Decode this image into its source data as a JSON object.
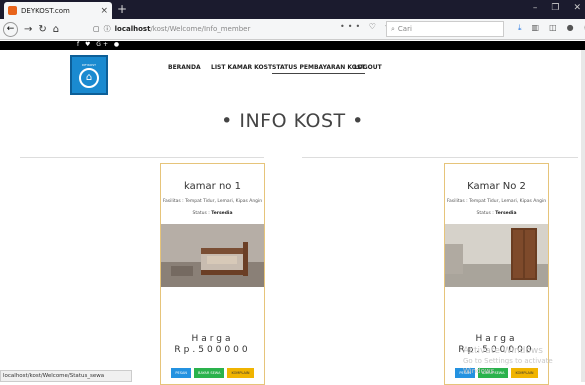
{
  "browser": {
    "tab_title": "DEYKOST.com",
    "tab_close": "×",
    "new_tab": "+",
    "url_host": "localhost",
    "url_path": "/kost/Welcome/Info_member",
    "search_placeholder": "Cari"
  },
  "site": {
    "social": "f ♥ G+ ●",
    "logo_text": "DEYKOST",
    "menu": [
      "BERANDA",
      "LIST KAMAR KOST",
      "STATUS PEMBAYARAN KOST",
      "LOGOUT"
    ],
    "heading": "• INFO KOST •"
  },
  "rooms": [
    {
      "name": "kamar no 1",
      "facilities": "Fasilitas : Tempat Tidur, Lemari, Kipas Angin",
      "status_label": "Status :",
      "status_value": "Tersedia",
      "price_label": "Harga",
      "price_value": "Rp.500000",
      "buttons": [
        "PESAN",
        "BAYAR SEWA",
        "KOMPLAIN"
      ]
    },
    {
      "name": "Kamar No 2",
      "facilities": "Fasilitas : Tempat Tidur, Lemari, Kipas Angin",
      "status_label": "Status :",
      "status_value": "Tersedia",
      "price_label": "Harga",
      "price_value": "Rp.500000",
      "buttons": [
        "PESAN",
        "BAYAR SEWA",
        "KOMPLAIN"
      ]
    }
  ],
  "status_bar": "localhost/kost/Welcome/Status_sewa",
  "watermark": {
    "line1": "Activate Windows",
    "line2": "Go to Settings to activate Windows."
  }
}
